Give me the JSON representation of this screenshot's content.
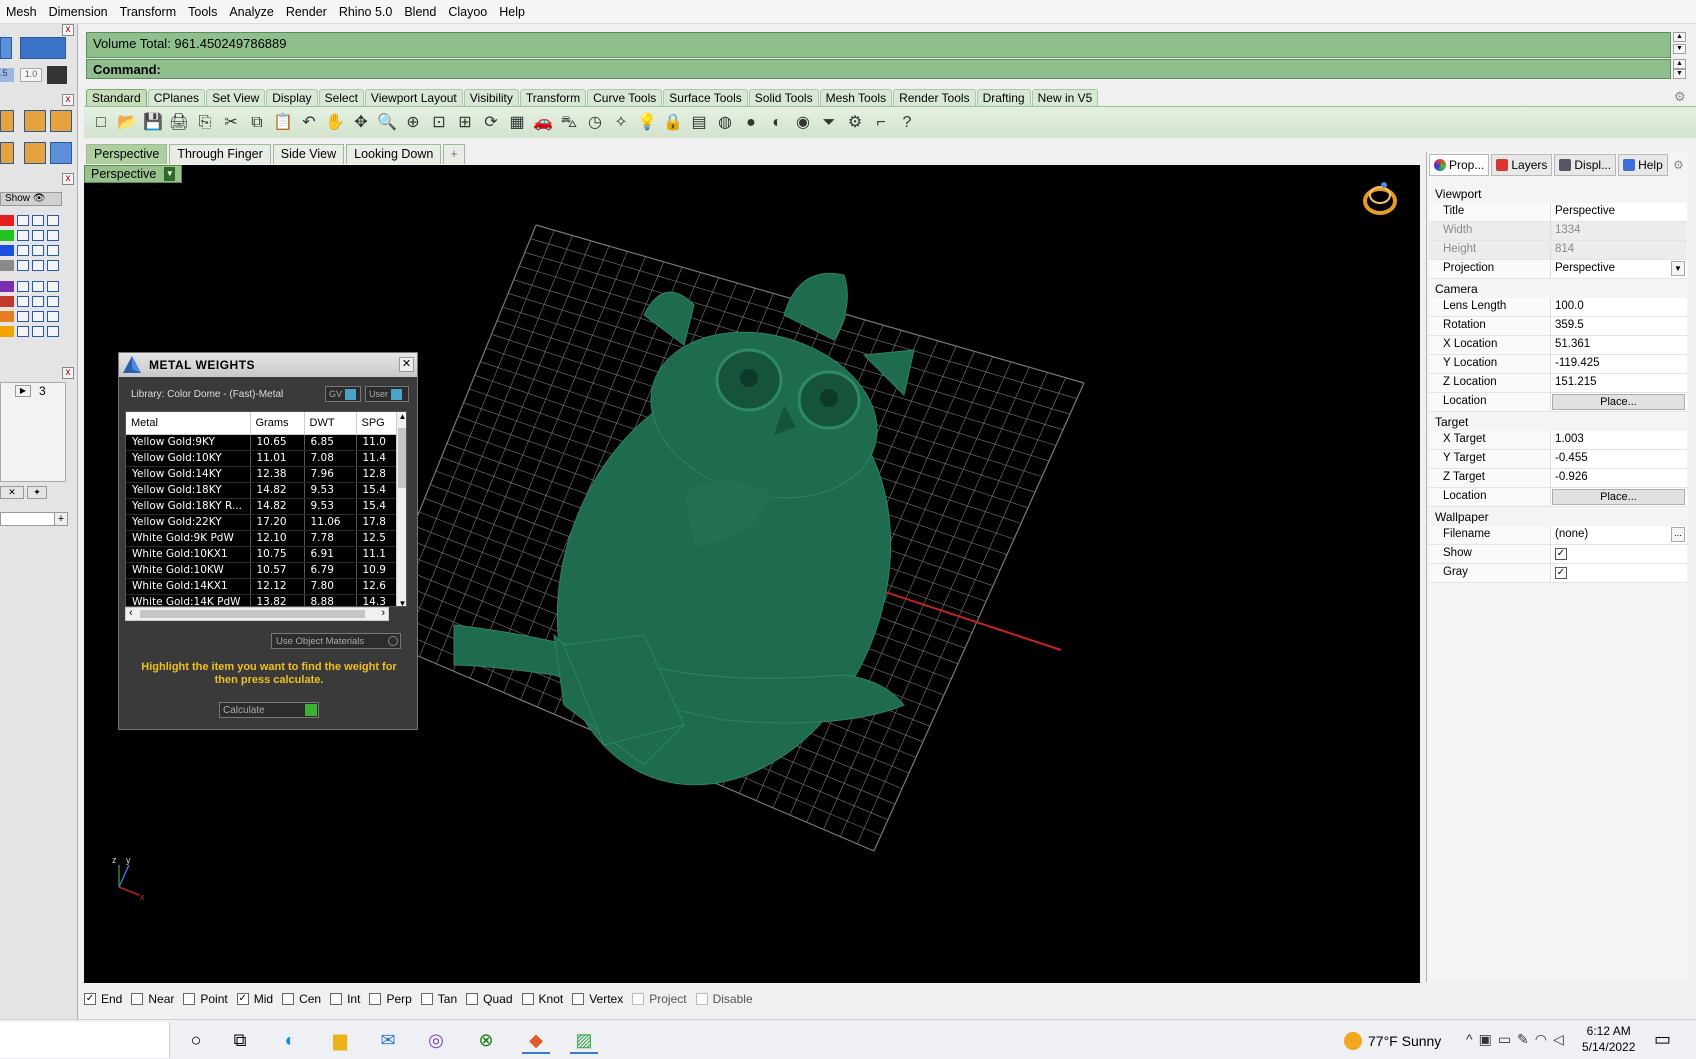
{
  "menu": [
    "Mesh",
    "Dimension",
    "Transform",
    "Tools",
    "Analyze",
    "Render",
    "Rhino 5.0",
    "Blend",
    "Clayoo",
    "Help"
  ],
  "command": {
    "history": "Volume Total: 961.450249786889",
    "prompt": "Command:"
  },
  "toolbar_tabs": [
    "Standard",
    "CPlanes",
    "Set View",
    "Display",
    "Select",
    "Viewport Layout",
    "Visibility",
    "Transform",
    "Curve Tools",
    "Surface Tools",
    "Solid Tools",
    "Mesh Tools",
    "Render Tools",
    "Drafting",
    "New in V5"
  ],
  "toolbar_icons": [
    "new-icon",
    "open-icon",
    "save-icon",
    "print-icon",
    "import-icon",
    "cut-icon",
    "copy-icon",
    "paste-icon",
    "undo-icon",
    "pan-icon",
    "move-view-icon",
    "zoom-icon",
    "zoom-window-icon",
    "zoom-extents-icon",
    "zoom-selected-icon",
    "rotate-view-icon",
    "four-viewports-icon",
    "car-icon",
    "car-gray-icon",
    "clock-icon",
    "cplane-icon",
    "light-icon",
    "lock-icon",
    "layer-icon",
    "color-wheel-icon",
    "sphere-gray-icon",
    "sphere-shaded-icon",
    "sphere-blue-icon",
    "filter-icon",
    "gear-icon",
    "dimension-icon",
    "help-icon"
  ],
  "toolbar_glyphs": [
    "□",
    "📂",
    "💾",
    "🖨",
    "⎘",
    "✂",
    "⧉",
    "📋",
    "↶",
    "✋",
    "✥",
    "🔍",
    "⊕",
    "⊡",
    "⊞",
    "⟳",
    "▦",
    "🚗",
    "⛍",
    "◷",
    "✧",
    "💡",
    "🔒",
    "▤",
    "◍",
    "●",
    "◐",
    "◉",
    "⏷",
    "⚙",
    "⌐",
    "?"
  ],
  "viewport_tabs": [
    "Perspective",
    "Through Finger",
    "Side View",
    "Looking Down"
  ],
  "viewport": {
    "title": "Perspective",
    "background": "#000000",
    "model_color": "#1f6b4e",
    "grid_color": "#7a7a7a",
    "axis_x_color": "#c0261b",
    "axis_y_color": "#2f8a2f"
  },
  "left_dock": {
    "show_label": "Show",
    "layer_colors": [
      "#e21f1f",
      "#22c322",
      "#1b4fe0",
      "#8a8a8a",
      "#7a2eb0",
      "#c0392b",
      "#e67e22",
      "#f0a500"
    ],
    "number": "3",
    "unit_value": "1.0"
  },
  "metal_weights": {
    "title": "METAL WEIGHTS",
    "library": "Library: Color Dome - (Fast)-Metal",
    "gv_label": "GV",
    "user_label": "User",
    "columns": [
      "Metal",
      "Grams",
      "DWT",
      "SPG"
    ],
    "rows": [
      [
        "Yellow Gold:9KY",
        "10.65",
        "6.85",
        "11.0"
      ],
      [
        "Yellow Gold:10KY",
        "11.01",
        "7.08",
        "11.4"
      ],
      [
        "Yellow Gold:14KY",
        "12.38",
        "7.96",
        "12.8"
      ],
      [
        "Yellow Gold:18KY",
        "14.82",
        "9.53",
        "15.4"
      ],
      [
        "Yellow Gold:18KY R...",
        "14.82",
        "9.53",
        "15.4"
      ],
      [
        "Yellow Gold:22KY",
        "17.20",
        "11.06",
        "17.8"
      ],
      [
        "White Gold:9K PdW",
        "12.10",
        "7.78",
        "12.5"
      ],
      [
        "White Gold:10KX1",
        "10.75",
        "6.91",
        "11.1"
      ],
      [
        "White Gold:10KW",
        "10.57",
        "6.79",
        "10.9"
      ],
      [
        "White Gold:14KX1",
        "12.12",
        "7.80",
        "12.6"
      ],
      [
        "White Gold:14K PdW",
        "13.82",
        "8.88",
        "14.3"
      ]
    ],
    "use_object_materials": "Use Object Materials",
    "hint": "Highlight the item you want to find the weight for then press calculate.",
    "calculate": "Calculate"
  },
  "properties": {
    "tabs": [
      "Prop...",
      "Layers",
      "Displ...",
      "Help"
    ],
    "viewport_section": "Viewport",
    "title_label": "Title",
    "title_value": "Perspective",
    "width_label": "Width",
    "width_value": "1334",
    "height_label": "Height",
    "height_value": "814",
    "projection_label": "Projection",
    "projection_value": "Perspective",
    "camera_section": "Camera",
    "lens_label": "Lens Length",
    "lens_value": "100.0",
    "rotation_label": "Rotation",
    "rotation_value": "359.5",
    "xloc_label": "X Location",
    "xloc_value": "51.361",
    "yloc_label": "Y Location",
    "yloc_value": "-119.425",
    "zloc_label": "Z Location",
    "zloc_value": "151.215",
    "location_label": "Location",
    "place_label": "Place...",
    "target_section": "Target",
    "xt_label": "X Target",
    "xt_value": "1.003",
    "yt_label": "Y Target",
    "yt_value": "-0.455",
    "zt_label": "Z Target",
    "zt_value": "-0.926",
    "wallpaper_section": "Wallpaper",
    "filename_label": "Filename",
    "filename_value": "(none)",
    "show_label": "Show",
    "show_checked": true,
    "gray_label": "Gray",
    "gray_checked": true
  },
  "osnaps": [
    {
      "label": "End",
      "checked": true
    },
    {
      "label": "Near",
      "checked": false
    },
    {
      "label": "Point",
      "checked": false
    },
    {
      "label": "Mid",
      "checked": true
    },
    {
      "label": "Cen",
      "checked": false
    },
    {
      "label": "Int",
      "checked": false
    },
    {
      "label": "Perp",
      "checked": false
    },
    {
      "label": "Tan",
      "checked": false
    },
    {
      "label": "Quad",
      "checked": false
    },
    {
      "label": "Knot",
      "checked": false
    },
    {
      "label": "Vertex",
      "checked": false
    },
    {
      "label": "Project",
      "checked": false,
      "disabled": true
    },
    {
      "label": "Disable",
      "checked": false,
      "disabled": true
    }
  ],
  "taskbar": {
    "weather": "77°F  Sunny",
    "time": "6:12 AM",
    "date": "5/14/2022"
  }
}
